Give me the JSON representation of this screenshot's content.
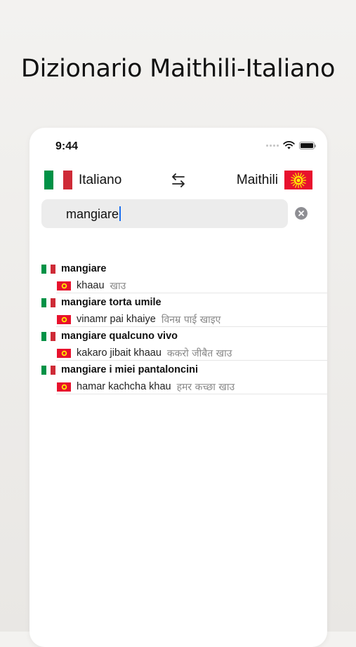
{
  "headline": "Dizionario Maithili-Italiano",
  "status_bar": {
    "time": "9:44"
  },
  "languages": {
    "source": "Italiano",
    "target": "Maithili"
  },
  "search": {
    "value": "mangiare"
  },
  "colors": {
    "italy_green": "#009246",
    "italy_white": "#ffffff",
    "italy_red": "#ce2b37",
    "kyrgyz_red": "#e8112d",
    "kyrgyz_sun": "#ffef00",
    "caret": "#1a6ff0"
  },
  "results": [
    {
      "term": "mangiare",
      "translit": "khaau",
      "native": "खाउ"
    },
    {
      "term": "mangiare torta umile",
      "translit": "vinamr pai khaiye",
      "native": "विनम्र पाई खाइए"
    },
    {
      "term": "mangiare qualcuno vivo",
      "translit": "kakaro jibait khaau",
      "native": "ककरो जीबैत खाउ"
    },
    {
      "term": "mangiare i miei pantaloncini",
      "translit": "hamar kachcha khau",
      "native": "हमर कच्छा खाउ"
    }
  ]
}
